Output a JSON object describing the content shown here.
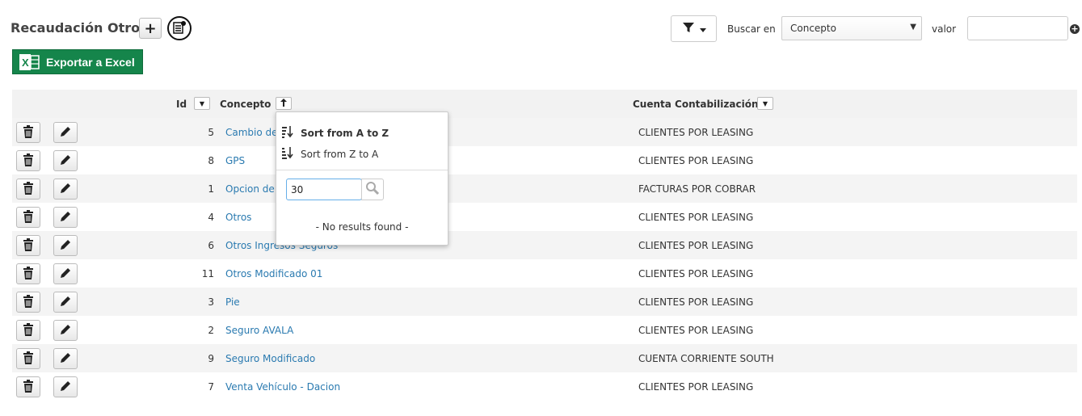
{
  "header": {
    "title": "Recaudación Otros",
    "add_label": "+",
    "excel_label": "Exportar a Excel",
    "buscar_label": "Buscar en",
    "search_field_value": "Concepto",
    "valor_label": "valor",
    "valor_value": ""
  },
  "columns": {
    "id": "Id",
    "concepto": "Concepto",
    "cuenta": "Cuenta Contabilización"
  },
  "rows": [
    {
      "id": "5",
      "concepto": "Cambio de",
      "cuenta": "CLIENTES POR LEASING"
    },
    {
      "id": "8",
      "concepto": "GPS",
      "cuenta": "CLIENTES POR LEASING"
    },
    {
      "id": "1",
      "concepto": "Opcion de",
      "cuenta": "FACTURAS POR COBRAR"
    },
    {
      "id": "4",
      "concepto": "Otros",
      "cuenta": "CLIENTES POR LEASING"
    },
    {
      "id": "6",
      "concepto": "Otros Ingresos Seguros",
      "cuenta": "CLIENTES POR LEASING"
    },
    {
      "id": "11",
      "concepto": "Otros Modificado 01",
      "cuenta": "CLIENTES POR LEASING"
    },
    {
      "id": "3",
      "concepto": "Pie",
      "cuenta": "CLIENTES POR LEASING"
    },
    {
      "id": "2",
      "concepto": "Seguro AVALA",
      "cuenta": "CLIENTES POR LEASING"
    },
    {
      "id": "9",
      "concepto": "Seguro Modificado",
      "cuenta": "CUENTA CORRIENTE SOUTH"
    },
    {
      "id": "7",
      "concepto": "Venta Vehículo - Dacion",
      "cuenta": "CLIENTES POR LEASING"
    }
  ],
  "popup": {
    "sort_asc": "Sort from A to Z",
    "sort_desc": "Sort from Z to A",
    "search_value": "30",
    "no_results": "- No results found -"
  },
  "colors": {
    "excel_green": "#15854b",
    "link_blue": "#2a7ab0",
    "row_stripe": "#f4f4f4"
  }
}
